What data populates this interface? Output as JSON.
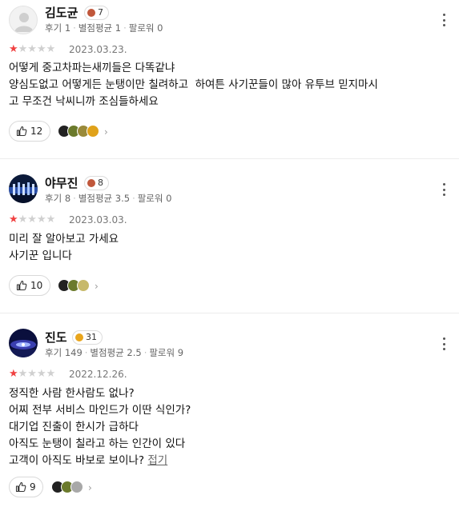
{
  "reviews": [
    {
      "name": "김도균",
      "level": "7",
      "level_color": "#c0573b",
      "reviews_label": "후기 1",
      "avg_label": "별점평균 1",
      "followers_label": "팔로워 0",
      "rating": 1,
      "date": "2023.03.23.",
      "body": "어떻게 중고차파는새끼들은 다똑같냐\n양심도없고 어떻게든 눈탱이만 칠려하고  하여튼 사기꾼들이 많아 유투브 믿지마시\n고 무조건 낙씨니까 조심들하세요",
      "likes": "12",
      "fold": ""
    },
    {
      "name": "야무진",
      "level": "8",
      "level_color": "#c0573b",
      "reviews_label": "후기 8",
      "avg_label": "별점평균 3.5",
      "followers_label": "팔로워 0",
      "rating": 1,
      "date": "2023.03.03.",
      "body": "미리 잘 알아보고 가세요\n사기꾼 입니다",
      "likes": "10",
      "fold": ""
    },
    {
      "name": "진도",
      "level": "31",
      "level_color": "#e9a51c",
      "reviews_label": "후기 149",
      "avg_label": "별점평균 2.5",
      "followers_label": "팔로워 9",
      "rating": 1,
      "date": "2022.12.26.",
      "body": "정직한 사람 한사람도 없나?\n어찌 전부 서비스 마인드가 이딴 식인가?\n대기업 진출이 한시가 급하다\n아직도 눈탱이 칠라고 하는 인간이 있다\n고객이 아직도 바보로 보이나? ",
      "likes": "9",
      "fold": "접기"
    }
  ],
  "icons": {
    "like": "thumbs-up-icon",
    "more": "more-vertical-icon",
    "chevron": "chevron-right-icon",
    "star": "star-icon"
  },
  "colors": {
    "star_on": "#f04141",
    "star_off": "#d0d0d0"
  }
}
